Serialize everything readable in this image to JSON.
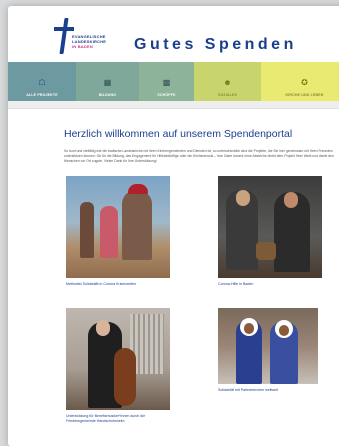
{
  "header": {
    "logo_line1": "EVANGELISCHE",
    "logo_line2": "LANDESKIRCHE",
    "logo_line3": "IN BADEN",
    "site_title": "Gutes Spenden"
  },
  "nav": {
    "items": [
      {
        "label": "ALLE PROJEKTE",
        "icon": "home-icon"
      },
      {
        "label": "BILDUNG",
        "icon": "book-icon"
      },
      {
        "label": "SCHÖPFE",
        "icon": "grid-icon"
      },
      {
        "label": "SOZIALES",
        "icon": "people-icon"
      },
      {
        "label": "KIRCHE UND LEBEN",
        "icon": "torch-icon"
      }
    ]
  },
  "main": {
    "welcome": "Herzlich willkommen auf unserem Spendenportal",
    "intro": "So bunt und vielfältig wie die badische Landeskirche mit ihren Kirchengemeinden und Diensten ist, so unterschiedlich sind die Projekte, die Sie hier gemeinsam mit Ihren Freunden unterstützen können. Ob für die Bildung, das Engagement für Hilfsbedürftige oder die Kirchenmusik – Ihre Gabe kommt ohne Abstriche direkt dem Projekt Ihrer Wahl und damit den Menschen vor Ort zugute. Vielen Dank für Ihre Unterstützung!",
    "cards": [
      {
        "caption": "Methodist Solidarität in Corona Krisenzeiten"
      },
      {
        "caption": "Corona-Hilfe in Baden"
      },
      {
        "caption": "Unterstützung für Benefizmusiker*innen durch die Friedensgemeinde Handschuhsheim"
      },
      {
        "caption": "Solidarität mit Partnerkirchen weltweit"
      }
    ]
  }
}
